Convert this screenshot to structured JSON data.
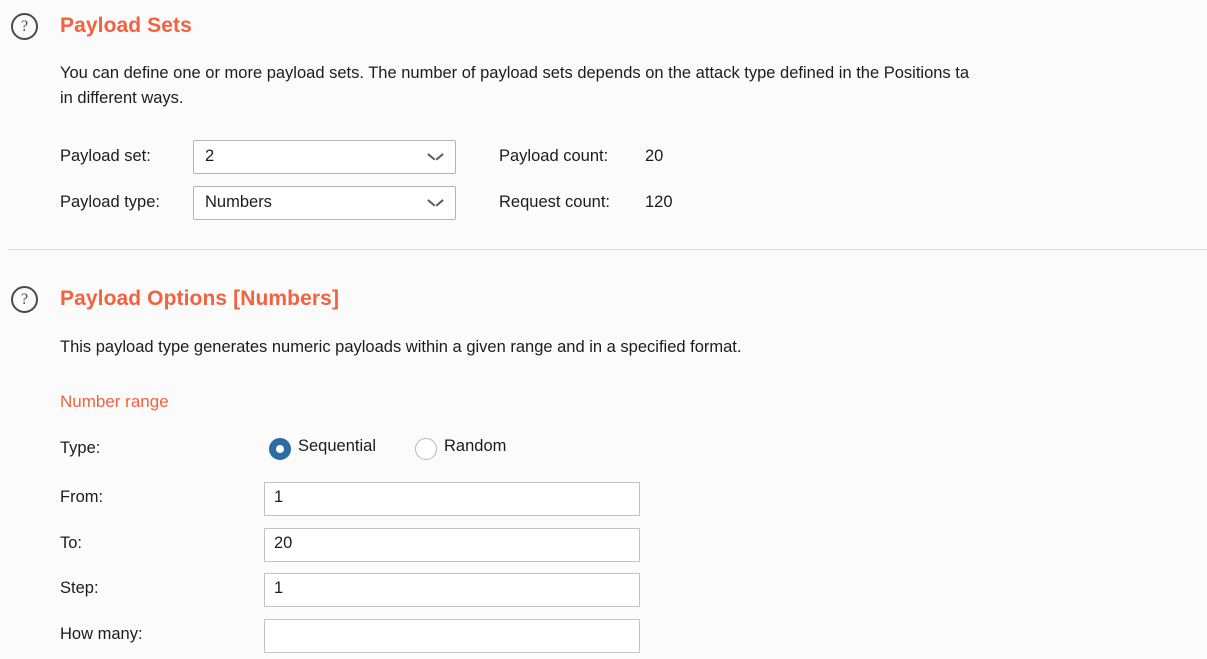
{
  "payload_sets": {
    "help_icon": "help-question-icon",
    "title": "Payload Sets",
    "description_line1": "You can define one or more payload sets. The number of payload sets depends on the attack type defined in the Positions ta",
    "description_line2": "in different ways.",
    "payload_set_label": "Payload set:",
    "payload_set_value": "2",
    "payload_type_label": "Payload type:",
    "payload_type_value": "Numbers",
    "payload_count_label": "Payload count:",
    "payload_count_value": "20",
    "request_count_label": "Request count:",
    "request_count_value": "120",
    "chevron_icon": "chevron-down-icon"
  },
  "payload_options": {
    "help_icon": "help-question-icon",
    "title": "Payload Options [Numbers]",
    "description": "This payload type generates numeric payloads within a given range and in a specified format.",
    "number_range_heading": "Number range",
    "type_label": "Type:",
    "type_options": [
      {
        "label": "Sequential",
        "selected": true
      },
      {
        "label": "Random",
        "selected": false
      }
    ],
    "from_label": "From:",
    "from_value": "1",
    "to_label": "To:",
    "to_value": "20",
    "step_label": "Step:",
    "step_value": "1",
    "how_many_label": "How many:",
    "how_many_value": ""
  },
  "colors": {
    "accent_orange": "#f4613e",
    "radio_selected_blue": "#2c6ca5",
    "background": "#fbfbfb"
  }
}
